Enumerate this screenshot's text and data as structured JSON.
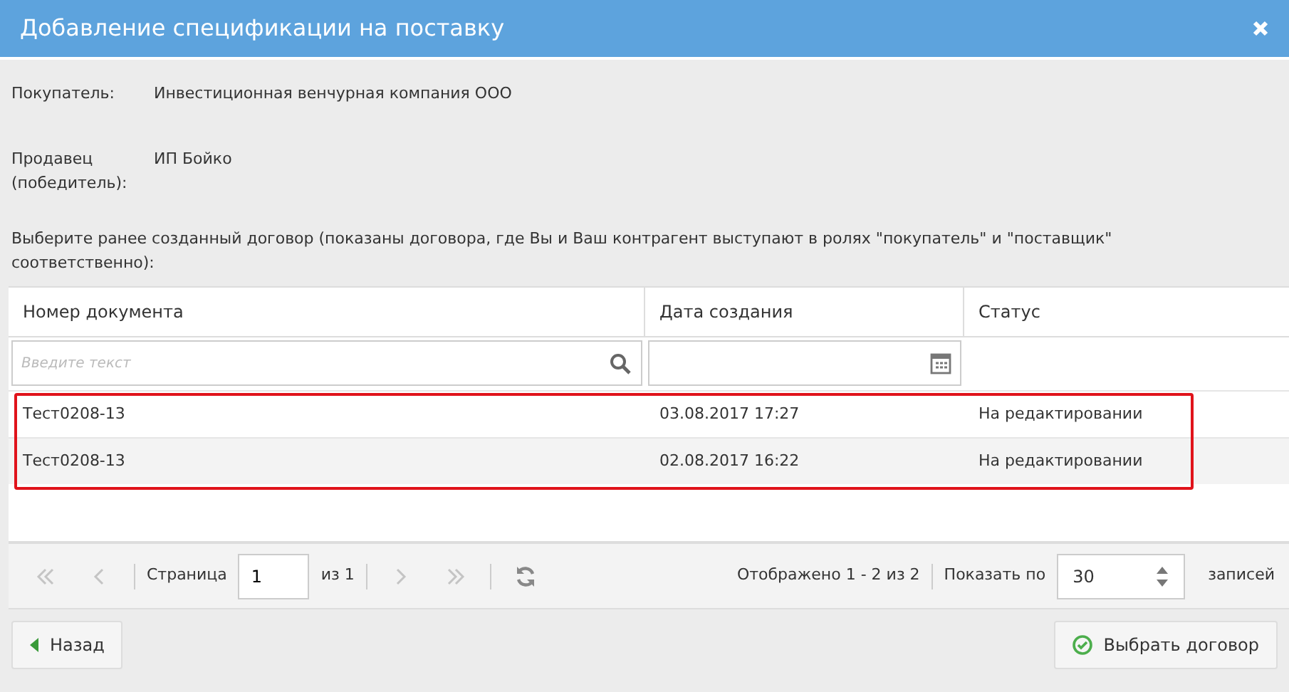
{
  "window": {
    "title": "Добавление спецификации на поставку"
  },
  "fields": [
    {
      "label": "Покупатель:",
      "value": "Инвестиционная венчурная компания ООО"
    },
    {
      "label": "Продавец (победитель):",
      "value": "ИП Бойко"
    }
  ],
  "instructions": "Выберите ранее созданный договор (показаны договора, где Вы и Ваш контрагент выступают в ролях \"покупатель\" и \"поставщик\" соответственно):",
  "table": {
    "columns": [
      "Номер документа",
      "Дата создания",
      "Статус"
    ],
    "filters": [
      {
        "kind": "text",
        "placeholder": "Введите текст"
      },
      {
        "kind": "date"
      },
      {
        "kind": "none"
      }
    ],
    "rows_framed": true,
    "rows": [
      [
        "Тест0208-13",
        "03.08.2017 17:27",
        "На редактировании"
      ],
      [
        "Тест0208-13",
        "02.08.2017 16:22",
        "На редактировании"
      ]
    ]
  },
  "pager": {
    "nav": [
      {
        "kind": "first",
        "disabled": true
      },
      {
        "kind": "prev",
        "disabled": true
      },
      {
        "kind": "next",
        "disabled": true
      },
      {
        "kind": "last",
        "disabled": true
      }
    ],
    "page_label": "Страница",
    "page": "1",
    "of_label": "из 1",
    "summary": "Отображено 1 - 2 из 2",
    "per_page_label": "Показать по",
    "per_page": "30",
    "records_label": "записей"
  },
  "buttons": [
    {
      "kind": "back",
      "label": "Назад"
    },
    {
      "kind": "confirm",
      "label": "Выбрать договор"
    }
  ]
}
